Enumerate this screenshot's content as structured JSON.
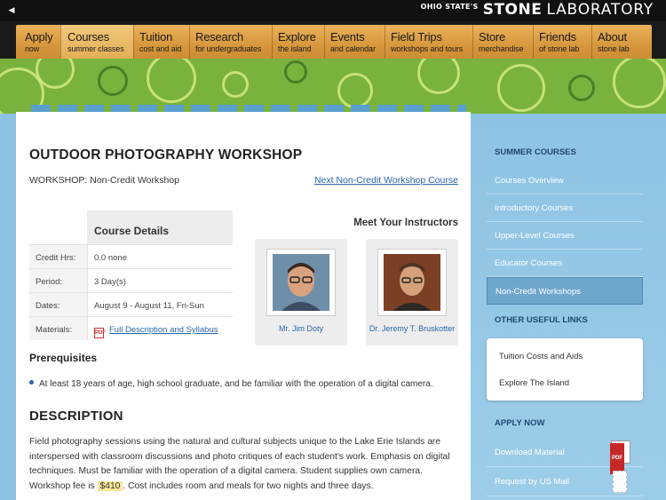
{
  "brand": {
    "prefix": "OHIO STATE'S",
    "name": "STONE",
    "suffix": "LABORATORY"
  },
  "nav": [
    {
      "title": "Apply",
      "sub": "now"
    },
    {
      "title": "Courses",
      "sub": "summer classes",
      "active": true
    },
    {
      "title": "Tuition",
      "sub": "cost and aid"
    },
    {
      "title": "Research",
      "sub": "for undergraduates"
    },
    {
      "title": "Explore",
      "sub": "the island"
    },
    {
      "title": "Events",
      "sub": "and calendar"
    },
    {
      "title": "Field Trips",
      "sub": "workshops and tours"
    },
    {
      "title": "Store",
      "sub": "merchandise"
    },
    {
      "title": "Friends",
      "sub": "of stone lab"
    },
    {
      "title": "About",
      "sub": "stone lab"
    }
  ],
  "course": {
    "title": "OUTDOOR PHOTOGRAPHY WORKSHOP",
    "subtitle": "WORKSHOP: Non-Credit Workshop",
    "next_link": "Next Non-Credit Workshop Course",
    "details_heading": "Course Details",
    "details": [
      {
        "label": "Credit Hrs:",
        "value": "0.0 none"
      },
      {
        "label": "Period:",
        "value": "3 Day(s)"
      },
      {
        "label": "Dates:",
        "value": "August 9 - August 11, Fri-Sun"
      },
      {
        "label": "Materials:",
        "value": "Full Description and Syllabus"
      }
    ],
    "instructors_heading": "Meet Your Instructors",
    "instructors": [
      {
        "name": "Mr. Jim Doty"
      },
      {
        "name": "Dr. Jeremy T. Bruskotter"
      }
    ],
    "prereq_heading": "Prerequisites",
    "prereq_item": "At least 18 years of age, high school graduate, and be familiar with the operation of a digital camera.",
    "desc_heading": "DESCRIPTION",
    "desc_before": "Field photography sessions using the natural and cultural subjects unique to the Lake Erie Islands are interspersed with classroom discussions and photo critiques of each student's work. Emphasis on digital techniques. Must be familiar with the operation of a digital camera. Student supplies own camera. Workshop fee is ",
    "desc_fee": "$410",
    "desc_after": ". Cost includes room and meals for two nights and three days."
  },
  "sidebar": {
    "summer_heading": "SUMMER COURSES",
    "summer_items": [
      "Courses Overview",
      "Introductory Courses",
      "Upper-Level Courses",
      "Educator Courses",
      "Non-Credit Workshops"
    ],
    "useful_heading": "OTHER USEFUL LINKS",
    "useful_items": [
      "Tuition Costs and Aids",
      "Explore The Island"
    ],
    "apply_heading": "APPLY NOW",
    "apply_items": [
      "Download Material",
      "Request by US Mail"
    ]
  }
}
